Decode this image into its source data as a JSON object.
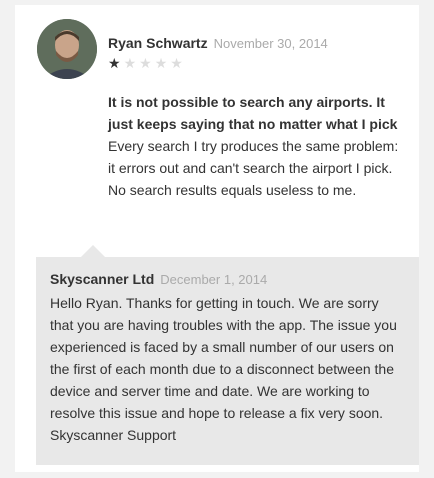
{
  "review": {
    "author": "Ryan Schwartz",
    "date": "November 30, 2014",
    "rating": 1,
    "rating_max": 5,
    "title": "It is not possible to search any airports. It just keeps saying that no matter what I pick",
    "body": "Every search I try produces the same problem: it errors out and can't search the airport I pick. No search results equals useless to me."
  },
  "reply": {
    "author": "Skyscanner Ltd",
    "date": "December 1, 2014",
    "body": "Hello Ryan. Thanks for getting in touch. We are sorry that you are having troubles with the app. The issue you experienced is faced by a small number of our users on the first of each month due to a disconnect between the device and server time and date. We are working to resolve this issue and hope to release a fix very soon. Skyscanner Support"
  },
  "colors": {
    "background": "#f2f2f2",
    "card": "#ffffff",
    "reply_background": "#e8e8e8",
    "star_filled": "#333333",
    "star_empty": "#dddddd"
  },
  "icons": {
    "star": "star-icon"
  }
}
